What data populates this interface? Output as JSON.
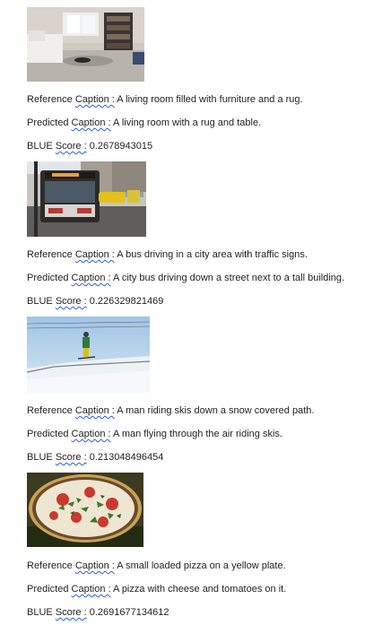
{
  "results": [
    {
      "image": "living-room-photo",
      "reference_label": "Reference",
      "reference_caption_word": "Caption :",
      "reference_text": " A living room filled with furniture and a rug.",
      "predicted_label": "Predicted",
      "predicted_caption_word": "Caption :",
      "predicted_text": " A living room with a rug and table.",
      "score_label": "BLUE",
      "score_word": "Score :",
      "score_value": " 0.2678943015"
    },
    {
      "image": "city-bus-photo",
      "reference_label": "Reference",
      "reference_caption_word": "Caption :",
      "reference_text": " A bus driving in a city area with traffic signs.",
      "predicted_label": "Predicted",
      "predicted_caption_word": "Caption :",
      "predicted_text": " A city bus driving down a street next to a tall building.",
      "score_label": "BLUE",
      "score_word": "Score :",
      "score_value": " 0.226329821469"
    },
    {
      "image": "skier-photo",
      "reference_label": "Reference",
      "reference_caption_word": "Caption :",
      "reference_text": " A man riding skis down a snow covered path.",
      "predicted_label": "Predicted",
      "predicted_caption_word": "Caption :",
      "predicted_text": " A man flying through the air riding skis.",
      "score_label": "BLUE",
      "score_word": "Score :",
      "score_value": " 0.213048496454"
    },
    {
      "image": "pizza-photo",
      "reference_label": "Reference",
      "reference_caption_word": "Caption :",
      "reference_text": " A small loaded pizza on a yellow plate.",
      "predicted_label": "Predicted",
      "predicted_caption_word": "Caption :",
      "predicted_text": " A pizza with cheese and tomatoes on it.",
      "score_label": "BLUE",
      "score_word": "Score :",
      "score_value": " 0.2691677134612"
    }
  ]
}
